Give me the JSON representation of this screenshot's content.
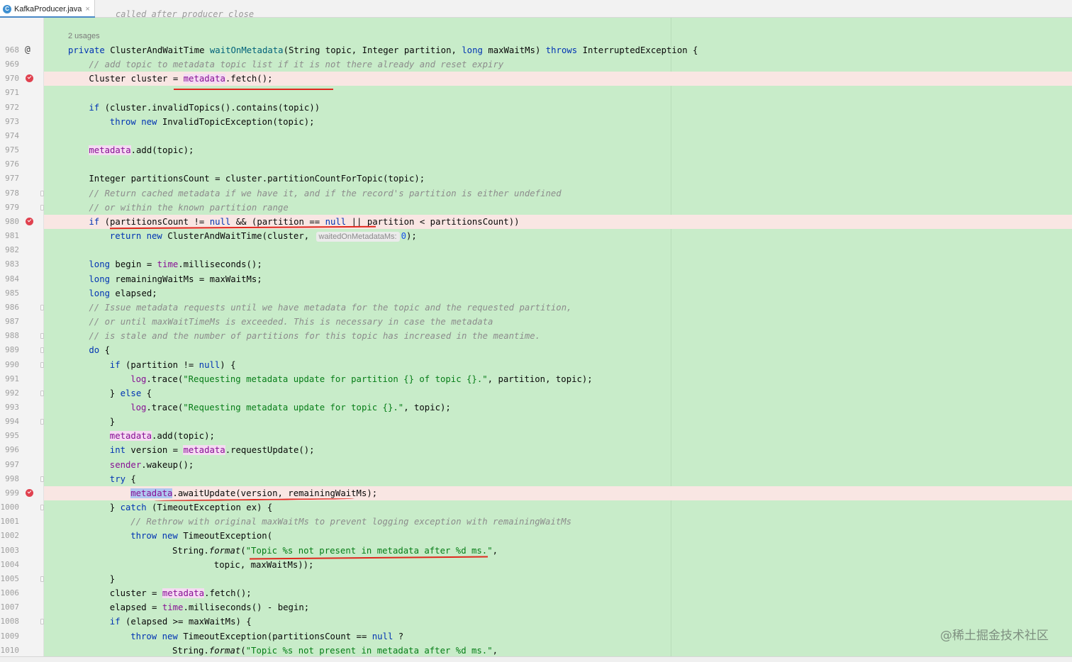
{
  "tab": {
    "icon_letter": "C",
    "title": "KafkaProducer.java",
    "close": "×"
  },
  "header": {
    "ghost_text": "called after producer close",
    "usages": "2 usages"
  },
  "lines": [
    {
      "n": "968",
      "i": 0,
      "g": "@",
      "t": [
        [
          "kw",
          "private "
        ],
        [
          "",
          "ClusterAndWaitTime "
        ],
        [
          "fn",
          "waitOnMetadata"
        ],
        [
          "",
          "(String topic, Integer partition, "
        ],
        [
          "kw",
          "long "
        ],
        [
          "",
          "maxWaitMs) "
        ],
        [
          "kw",
          "throws "
        ],
        [
          "",
          "InterruptedException {"
        ]
      ]
    },
    {
      "n": "969",
      "i": 1,
      "t": [
        [
          "cm",
          "// add topic to metadata topic list if it is not there already and reset expiry"
        ]
      ]
    },
    {
      "n": "970",
      "i": 1,
      "bp": true,
      "t": [
        [
          "",
          "Cluster cluster = "
        ],
        [
          "fld meta",
          "metadata"
        ],
        [
          "",
          ".fetch();"
        ]
      ]
    },
    {
      "n": "971",
      "i": 0,
      "t": []
    },
    {
      "n": "972",
      "i": 1,
      "t": [
        [
          "kw",
          "if "
        ],
        [
          "",
          "(cluster.invalidTopics().contains(topic))"
        ]
      ]
    },
    {
      "n": "973",
      "i": 2,
      "t": [
        [
          "kw",
          "throw new "
        ],
        [
          "",
          "InvalidTopicException(topic);"
        ]
      ]
    },
    {
      "n": "974",
      "i": 0,
      "t": []
    },
    {
      "n": "975",
      "i": 1,
      "t": [
        [
          "fld meta",
          "metadata"
        ],
        [
          "",
          ".add(topic);"
        ]
      ]
    },
    {
      "n": "976",
      "i": 0,
      "t": []
    },
    {
      "n": "977",
      "i": 1,
      "t": [
        [
          "",
          "Integer partitionsCount = cluster.partitionCountForTopic(topic);"
        ]
      ]
    },
    {
      "n": "978",
      "i": 1,
      "fold": true,
      "t": [
        [
          "cm",
          "// Return cached metadata if we have it, and if the record's partition is either undefined"
        ]
      ]
    },
    {
      "n": "979",
      "i": 1,
      "fold": true,
      "t": [
        [
          "cm",
          "// or within the known partition range"
        ]
      ]
    },
    {
      "n": "980",
      "i": 1,
      "bp": true,
      "t": [
        [
          "kw",
          "if "
        ],
        [
          "",
          "(partitionsCount != "
        ],
        [
          "kw",
          "null "
        ],
        [
          "",
          "&& (partition == "
        ],
        [
          "kw",
          "null "
        ],
        [
          "",
          "|| partition < partitionsCount))"
        ]
      ]
    },
    {
      "n": "981",
      "i": 2,
      "t": [
        [
          "kw",
          "return new "
        ],
        [
          "",
          "ClusterAndWaitTime(cluster, "
        ],
        [
          "hint",
          "waitedOnMetadataMs:"
        ],
        [
          "num",
          "0"
        ],
        [
          "",
          ");"
        ]
      ]
    },
    {
      "n": "982",
      "i": 0,
      "t": []
    },
    {
      "n": "983",
      "i": 1,
      "t": [
        [
          "kw",
          "long "
        ],
        [
          "",
          "begin = "
        ],
        [
          "fld",
          "time"
        ],
        [
          "",
          ".milliseconds();"
        ]
      ]
    },
    {
      "n": "984",
      "i": 1,
      "t": [
        [
          "kw",
          "long "
        ],
        [
          "",
          "remainingWaitMs = maxWaitMs;"
        ]
      ]
    },
    {
      "n": "985",
      "i": 1,
      "t": [
        [
          "kw",
          "long "
        ],
        [
          "",
          "elapsed;"
        ]
      ]
    },
    {
      "n": "986",
      "i": 1,
      "fold": true,
      "t": [
        [
          "cm",
          "// Issue metadata requests until we have metadata for the topic and the requested partition,"
        ]
      ]
    },
    {
      "n": "987",
      "i": 1,
      "t": [
        [
          "cm",
          "// or until maxWaitTimeMs is exceeded. This is necessary in case the metadata"
        ]
      ]
    },
    {
      "n": "988",
      "i": 1,
      "fold": true,
      "t": [
        [
          "cm",
          "// is stale and the number of partitions for this topic has increased in the meantime."
        ]
      ]
    },
    {
      "n": "989",
      "i": 1,
      "fold": true,
      "t": [
        [
          "kw",
          "do "
        ],
        [
          "",
          "{"
        ]
      ]
    },
    {
      "n": "990",
      "i": 2,
      "fold": true,
      "t": [
        [
          "kw",
          "if "
        ],
        [
          "",
          "(partition != "
        ],
        [
          "kw",
          "null"
        ],
        [
          "",
          ") {"
        ]
      ]
    },
    {
      "n": "991",
      "i": 3,
      "t": [
        [
          "fld",
          "log"
        ],
        [
          "",
          ".trace("
        ],
        [
          "str",
          "\"Requesting metadata update for partition {} of topic {}.\""
        ],
        [
          "",
          ", partition, topic);"
        ]
      ]
    },
    {
      "n": "992",
      "i": 2,
      "fold": true,
      "t": [
        [
          "",
          "} "
        ],
        [
          "kw",
          "else "
        ],
        [
          "",
          "{"
        ]
      ]
    },
    {
      "n": "993",
      "i": 3,
      "t": [
        [
          "fld",
          "log"
        ],
        [
          "",
          ".trace("
        ],
        [
          "str",
          "\"Requesting metadata update for topic {}.\""
        ],
        [
          "",
          ", topic);"
        ]
      ]
    },
    {
      "n": "994",
      "i": 2,
      "fold": true,
      "t": [
        [
          "",
          "}"
        ]
      ]
    },
    {
      "n": "995",
      "i": 2,
      "t": [
        [
          "fld meta",
          "metadata"
        ],
        [
          "",
          ".add(topic);"
        ]
      ]
    },
    {
      "n": "996",
      "i": 2,
      "t": [
        [
          "kw",
          "int "
        ],
        [
          "",
          "version = "
        ],
        [
          "fld meta",
          "metadata"
        ],
        [
          "",
          ".requestUpdate();"
        ]
      ]
    },
    {
      "n": "997",
      "i": 2,
      "t": [
        [
          "fld",
          "sender"
        ],
        [
          "",
          ".wakeup();"
        ]
      ]
    },
    {
      "n": "998",
      "i": 2,
      "fold": true,
      "t": [
        [
          "kw",
          "try "
        ],
        [
          "",
          "{"
        ]
      ]
    },
    {
      "n": "999",
      "i": 3,
      "bp": true,
      "t": [
        [
          "fld meta sel",
          "metadata"
        ],
        [
          "",
          ".awaitUpdate(version, remainingWaitMs);"
        ]
      ]
    },
    {
      "n": "1000",
      "i": 2,
      "fold": true,
      "t": [
        [
          "",
          "} "
        ],
        [
          "kw",
          "catch "
        ],
        [
          "",
          "(TimeoutException ex) {"
        ]
      ]
    },
    {
      "n": "1001",
      "i": 3,
      "t": [
        [
          "cm",
          "// Rethrow with original maxWaitMs to prevent logging exception with remainingWaitMs"
        ]
      ]
    },
    {
      "n": "1002",
      "i": 3,
      "t": [
        [
          "kw",
          "throw new "
        ],
        [
          "",
          "TimeoutException("
        ]
      ]
    },
    {
      "n": "1003",
      "i": 5,
      "t": [
        [
          "",
          "String."
        ],
        [
          "it",
          "format"
        ],
        [
          "",
          "("
        ],
        [
          "str",
          "\"Topic %s not present in metadata after %d ms.\""
        ],
        [
          "",
          ","
        ]
      ]
    },
    {
      "n": "1004",
      "i": 7,
      "t": [
        [
          "",
          "topic, maxWaitMs));"
        ]
      ]
    },
    {
      "n": "1005",
      "i": 2,
      "fold": true,
      "t": [
        [
          "",
          "}"
        ]
      ]
    },
    {
      "n": "1006",
      "i": 2,
      "t": [
        [
          "",
          "cluster = "
        ],
        [
          "fld meta",
          "metadata"
        ],
        [
          "",
          ".fetch();"
        ]
      ]
    },
    {
      "n": "1007",
      "i": 2,
      "t": [
        [
          "",
          "elapsed = "
        ],
        [
          "fld",
          "time"
        ],
        [
          "",
          ".milliseconds() - begin;"
        ]
      ]
    },
    {
      "n": "1008",
      "i": 2,
      "fold": true,
      "t": [
        [
          "kw",
          "if "
        ],
        [
          "",
          "(elapsed >= maxWaitMs) {"
        ]
      ]
    },
    {
      "n": "1009",
      "i": 3,
      "t": [
        [
          "kw",
          "throw new "
        ],
        [
          "",
          "TimeoutException(partitionsCount == "
        ],
        [
          "kw",
          "null "
        ],
        [
          "",
          "?"
        ]
      ]
    },
    {
      "n": "1010",
      "i": 5,
      "t": [
        [
          "",
          "String."
        ],
        [
          "it",
          "format"
        ],
        [
          "",
          "("
        ],
        [
          "str",
          "\"Topic %s not present in metadata after %d ms.\""
        ],
        [
          "",
          ","
        ]
      ]
    }
  ],
  "watermark": "@稀土掘金技术社区",
  "colors": {
    "editor_bg": "#c8ecc9",
    "breakpoint_line": "#f9e6e3",
    "annotation_red": "#e0281e"
  }
}
